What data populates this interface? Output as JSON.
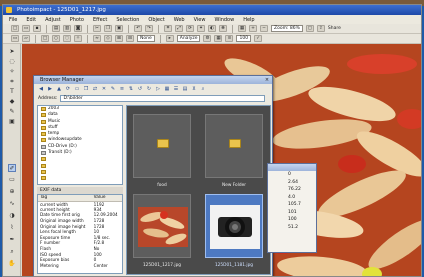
{
  "app": {
    "title": "Photoimpact - 125D01_1217.jpg"
  },
  "menu": [
    "File",
    "Edit",
    "Adjust",
    "Photo",
    "Effect",
    "Selection",
    "Object",
    "Web",
    "View",
    "Window",
    "Help"
  ],
  "toolbar2": {
    "zoom_label": "Zoom: 86%",
    "share_label": "Share"
  },
  "toolbar3": {
    "mode_value": "None",
    "angle_value": "Analyze",
    "size_value": "100"
  },
  "browser": {
    "title": "Browser Manager",
    "address_label": "Address:",
    "address_value": "D:\\bilder",
    "tree": [
      {
        "label": "2003",
        "type": "folder"
      },
      {
        "label": "data",
        "type": "folder"
      },
      {
        "label": "Music",
        "type": "folder"
      },
      {
        "label": "stuff",
        "type": "folder"
      },
      {
        "label": "temp",
        "type": "folder"
      },
      {
        "label": "windowsupdate",
        "type": "folder"
      },
      {
        "label": "CD-Drive (D:)",
        "type": "drive"
      },
      {
        "label": "Transit (D:)",
        "type": "drive"
      },
      {
        "label": "",
        "type": "folder"
      },
      {
        "label": "",
        "type": "folder"
      },
      {
        "label": "",
        "type": "folder"
      },
      {
        "label": "",
        "type": "folder"
      }
    ],
    "exif_title": "EXIF data",
    "exif_headers": [
      "Tag",
      "Value"
    ],
    "exif_rows": [
      [
        "current width",
        "1192"
      ],
      [
        "current height",
        "934"
      ],
      [
        "Date time first orig",
        "12.09.2004"
      ],
      [
        "Original image width",
        "1728"
      ],
      [
        "Original image height",
        "1728"
      ],
      [
        "Lens focal length",
        "10"
      ],
      [
        "Exposure time",
        "1/8 sec."
      ],
      [
        "F number",
        "F/2.8"
      ],
      [
        "Flash",
        "No"
      ],
      [
        "ISO speed",
        "100"
      ],
      [
        "Exposure bias",
        "0"
      ],
      [
        "Metering",
        "Center"
      ]
    ],
    "thumbs": [
      {
        "caption": "food",
        "kind": "folder"
      },
      {
        "caption": "New Folder",
        "kind": "folder"
      },
      {
        "caption": "125D01_1217.jpg",
        "kind": "food"
      },
      {
        "caption": "125D01_1181.jpg",
        "kind": "camera"
      }
    ]
  },
  "info_panel": {
    "values": [
      "0",
      "2.64",
      "76.22",
      "4.0",
      "105.7",
      "101",
      "100",
      "51.2"
    ]
  }
}
